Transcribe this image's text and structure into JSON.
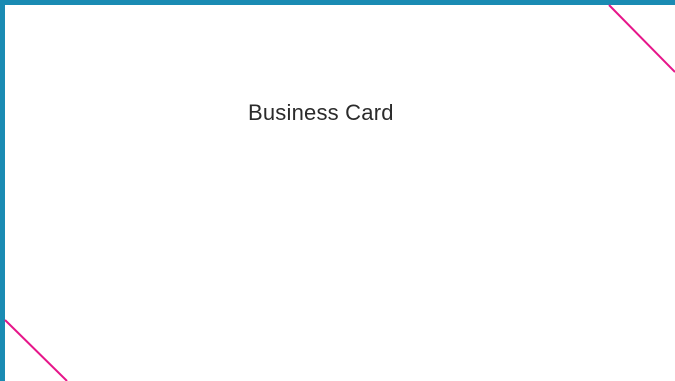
{
  "card": {
    "title": "Business Card"
  },
  "colors": {
    "border": "#1a8bb3",
    "accent_line": "#e6168a",
    "text": "#2b2b2b",
    "background": "#ffffff"
  }
}
